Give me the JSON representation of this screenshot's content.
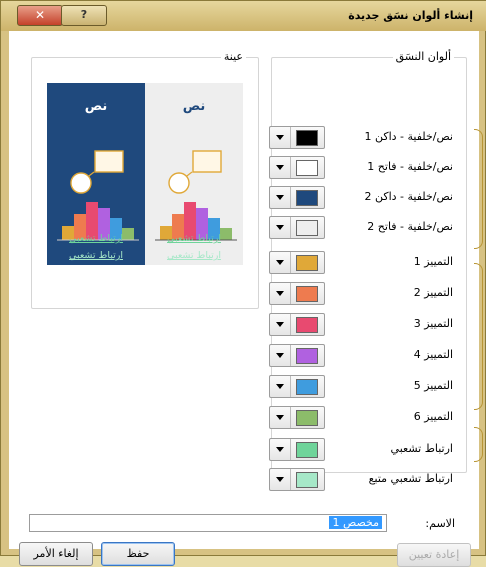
{
  "dialog": {
    "title": "إنشاء ألوان نسَق جديدة",
    "close_glyph": "✕",
    "help_glyph": "?"
  },
  "theme_group": {
    "legend": "ألوان النسَق",
    "rows": [
      {
        "label": "نص/خلفية - داكن 1",
        "color": "#000000"
      },
      {
        "label": "نص/خلفية - فاتح 1",
        "color": "#ffffff"
      },
      {
        "label": "نص/خلفية - داكن 2",
        "color": "#1f497d"
      },
      {
        "label": "نص/خلفية - فاتح 2",
        "color": "#eeeeee"
      },
      {
        "label": "التمييز 1",
        "color": "#e0a838"
      },
      {
        "label": "التمييز 2",
        "color": "#ee7b4f"
      },
      {
        "label": "التمييز 3",
        "color": "#e84a70"
      },
      {
        "label": "التمييز 4",
        "color": "#b061e0"
      },
      {
        "label": "التمييز 5",
        "color": "#3f9cde"
      },
      {
        "label": "التمييز 6",
        "color": "#8cbc6a"
      },
      {
        "label": "ارتباط تشعبي",
        "color": "#6fd49a"
      },
      {
        "label": "ارتباط تشعبي متبع",
        "color": "#a6e8c8"
      }
    ]
  },
  "sample_group": {
    "legend": "عينة",
    "light": {
      "title": "نص",
      "link": "ارتباط تشعبي",
      "followed": "ارتباط تشعبي"
    },
    "dark": {
      "title": "نص",
      "link": "ارتباط تشعبي",
      "followed": "ارتباط تشعبي"
    }
  },
  "name_field": {
    "label": "الاسم:",
    "value": "مخصص 1"
  },
  "buttons": {
    "reset": "إعادة تعيين",
    "save": "حفظ",
    "cancel": "إلغاء الأمر"
  },
  "colors": {
    "light_panel_bg": "#eeeeee",
    "dark_panel_bg": "#1f497d",
    "link_light": "#6fd49a",
    "link_followed_light": "#a6e8c8"
  }
}
